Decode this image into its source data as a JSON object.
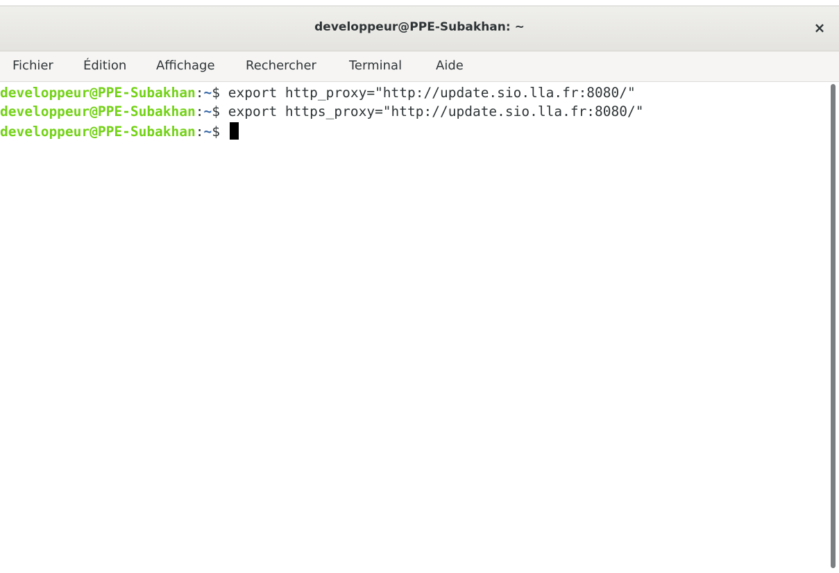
{
  "window": {
    "title": "developpeur@PPE-Subakhan: ~",
    "close_label": "×"
  },
  "menubar": {
    "items": [
      "Fichier",
      "Édition",
      "Affichage",
      "Rechercher",
      "Terminal",
      "Aide"
    ]
  },
  "terminal": {
    "lines": [
      {
        "user": "developpeur@PPE-Subakhan",
        "sep": ":",
        "path": "~",
        "prompt": "$ ",
        "command": "export http_proxy=\"http://update.sio.lla.fr:8080/\""
      },
      {
        "user": "developpeur@PPE-Subakhan",
        "sep": ":",
        "path": "~",
        "prompt": "$ ",
        "command": "export https_proxy=\"http://update.sio.lla.fr:8080/\""
      },
      {
        "user": "developpeur@PPE-Subakhan",
        "sep": ":",
        "path": "~",
        "prompt": "$ ",
        "command": ""
      }
    ]
  },
  "colors": {
    "prompt_user": "#73d216",
    "prompt_path": "#3465a4",
    "text": "#2e3436",
    "background": "#ffffff"
  }
}
